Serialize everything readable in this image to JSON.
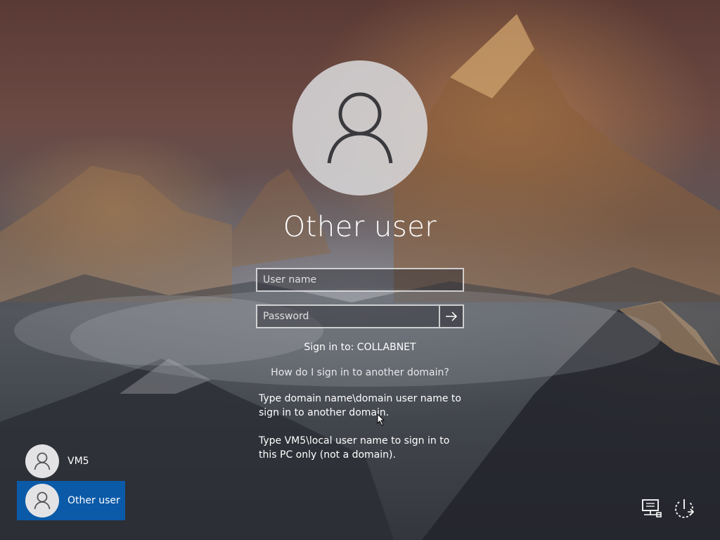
{
  "login": {
    "title": "Other user",
    "username_placeholder": "User name",
    "password_placeholder": "Password",
    "sign_in_to": "Sign in to: COLLABNET",
    "help_link": "How do I sign in to another domain?",
    "hint1": "Type domain name\\domain user name to sign in to another domain.",
    "hint2": "Type VM5\\local user name to sign in to this PC only (not a domain)."
  },
  "users": [
    {
      "label": "VM5",
      "selected": false
    },
    {
      "label": "Other user",
      "selected": true
    }
  ],
  "icons": {
    "avatar": "user-silhouette-icon",
    "submit": "arrow-right-icon",
    "network": "network-icon",
    "power": "power-icon"
  },
  "colors": {
    "selected_tile": "#0b5aa8"
  }
}
